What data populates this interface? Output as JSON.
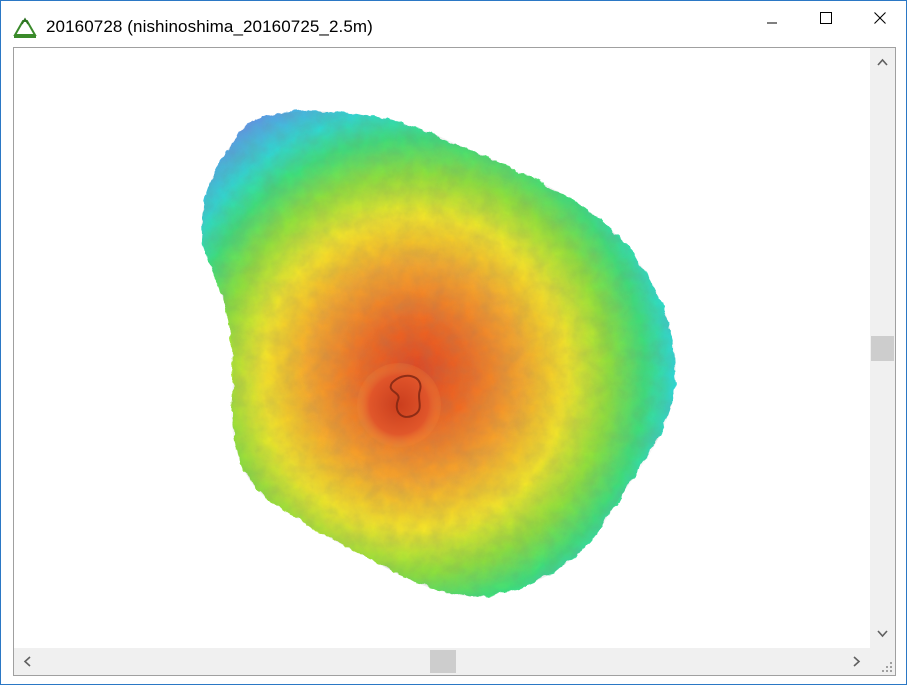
{
  "window": {
    "title": "20160728 (nishinoshima_20160725_2.5m)",
    "app_icon": "volcano-terrain-icon",
    "controls": {
      "minimize_icon": "minimize-icon",
      "maximize_icon": "maximize-icon",
      "close_icon": "close-icon"
    }
  },
  "map": {
    "subject": "Nishinoshima island shaded relief",
    "colors": {
      "low": "#5b9be6",
      "mid_low": "#2ee0c8",
      "mid": "#46e05a",
      "mid_high": "#f2ea2a",
      "high": "#f08a2a",
      "peak": "#e0441f"
    }
  },
  "scrollbars": {
    "vertical": {
      "up_icon": "chevron-up-icon",
      "down_icon": "chevron-down-icon",
      "position": 0.48
    },
    "horizontal": {
      "left_icon": "chevron-left-icon",
      "right_icon": "chevron-right-icon",
      "position": 0.49
    }
  }
}
